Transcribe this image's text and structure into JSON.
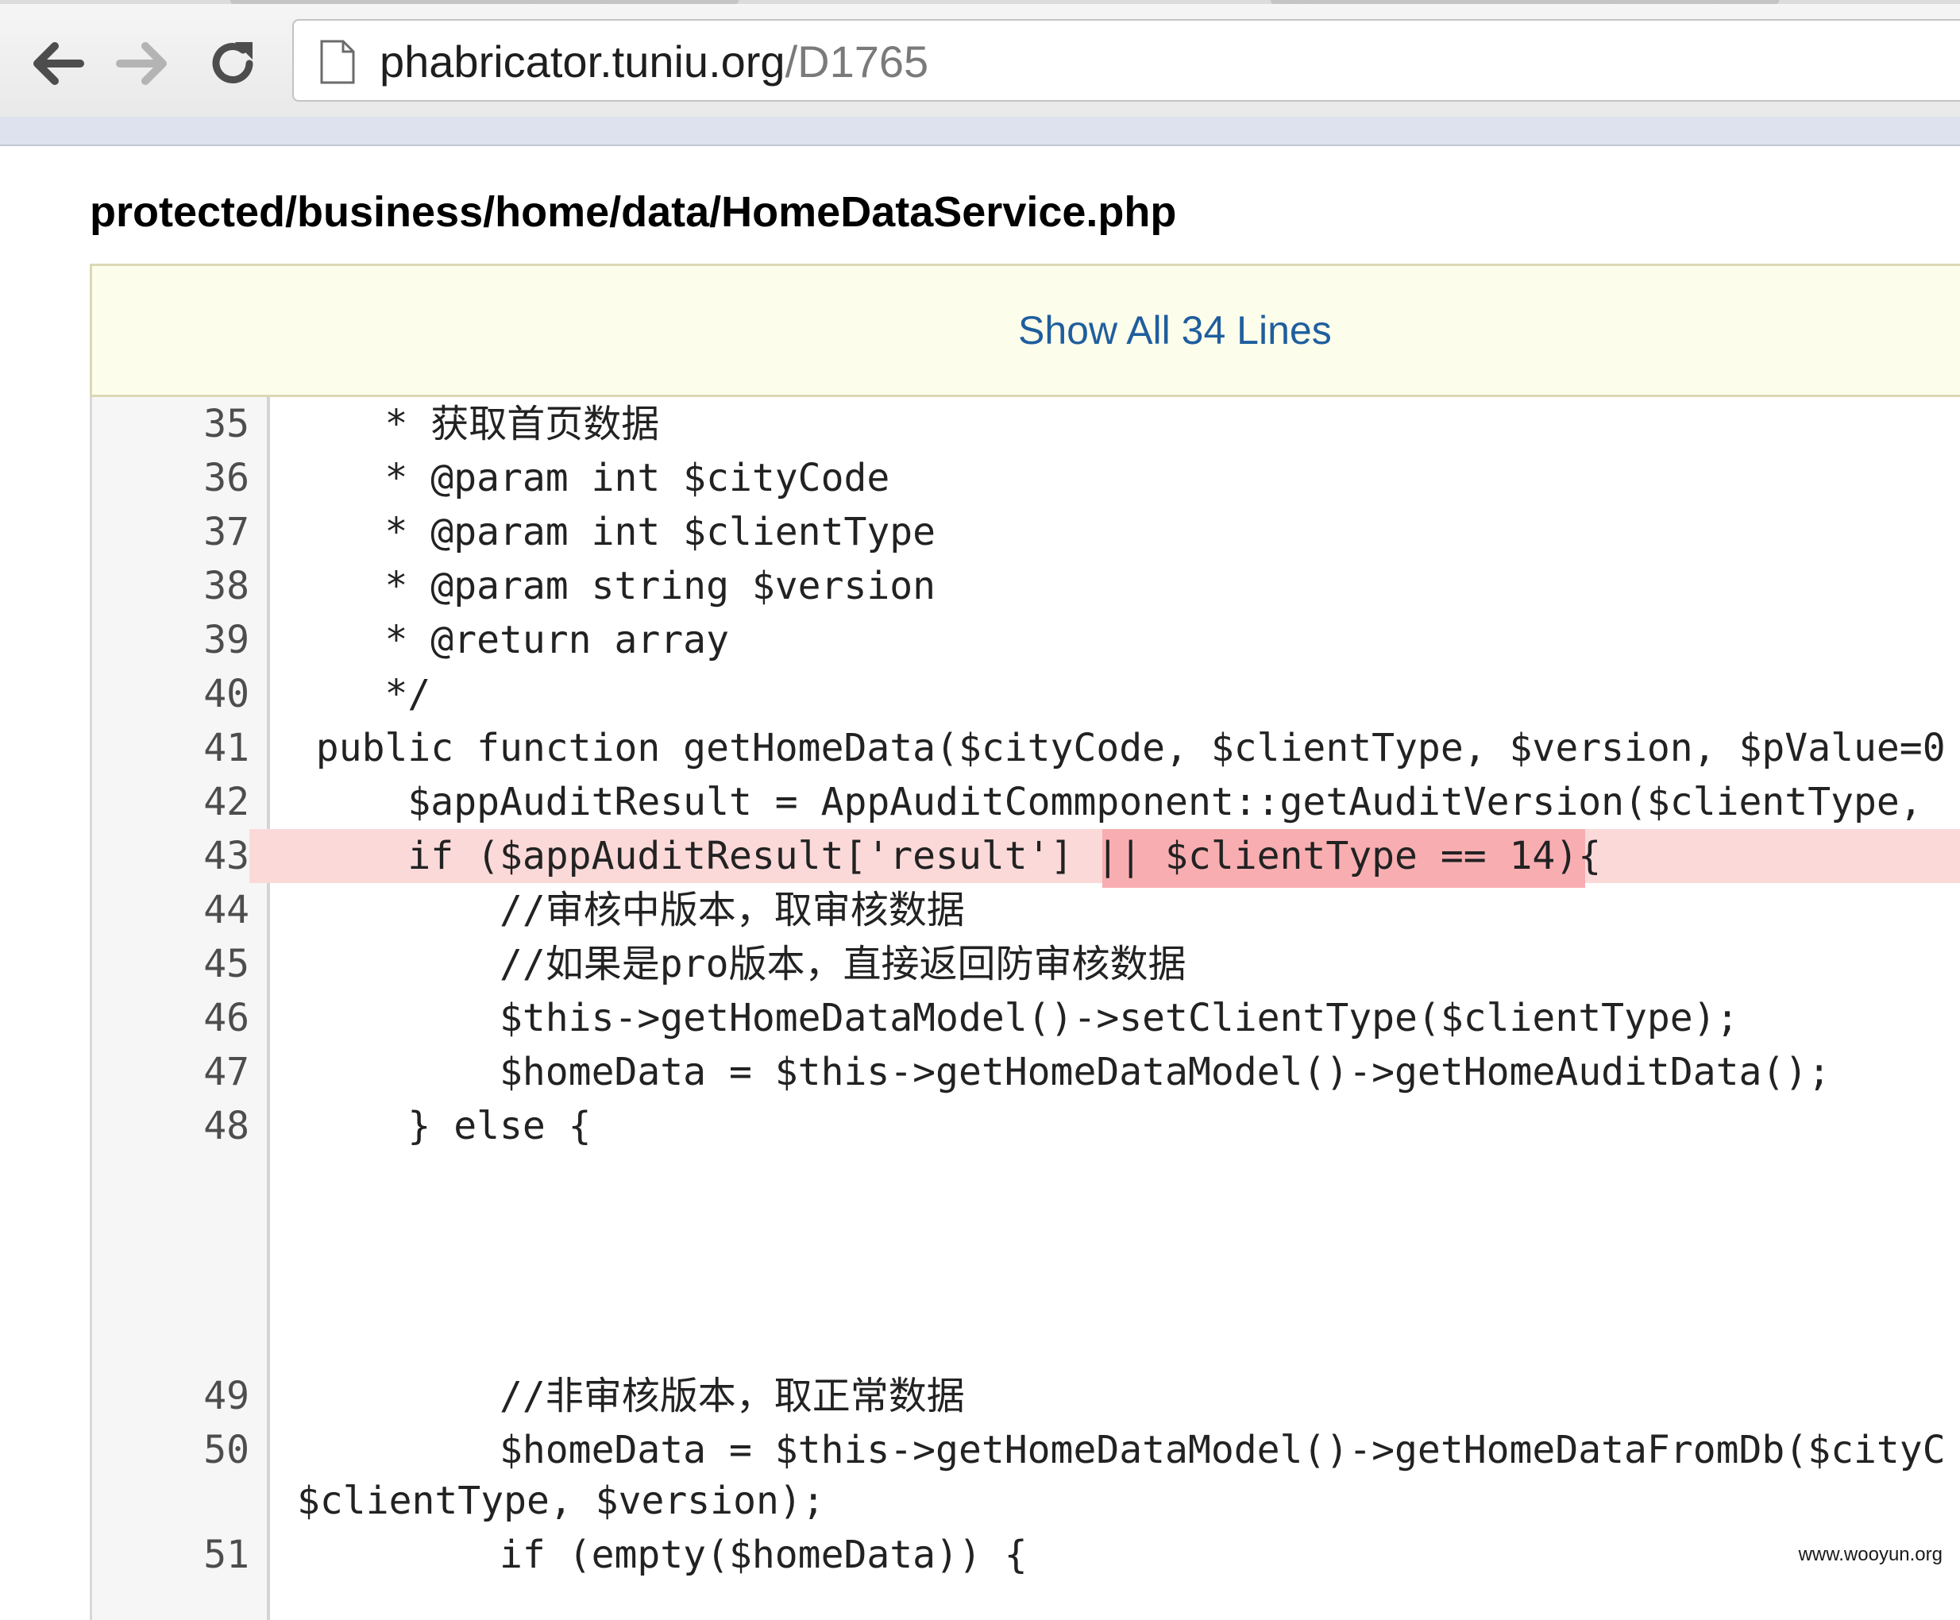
{
  "browser": {
    "url_host": "phabricator.tuniu.org",
    "url_path": "/D1765"
  },
  "file": {
    "path": "protected/business/home/data/HomeDataService.php"
  },
  "diff": {
    "show_all_label": "Show All 34 Lines",
    "lines": [
      {
        "num": "35",
        "text": "     * 获取首页数据"
      },
      {
        "num": "36",
        "text": "     * @param int $cityCode"
      },
      {
        "num": "37",
        "text": "     * @param int $clientType"
      },
      {
        "num": "38",
        "text": "     * @param string $version"
      },
      {
        "num": "39",
        "text": "     * @return array"
      },
      {
        "num": "40",
        "text": "     */"
      },
      {
        "num": "41",
        "text": "  public function getHomeData($cityCode, $clientType, $version, $pValue=0"
      },
      {
        "num": "42",
        "text": "      $appAuditResult = AppAuditCommponent::getAuditVersion($clientType,"
      },
      {
        "num": "43",
        "text": "      if ($appAuditResult['result'] || $clientType == 14){",
        "highlight": true
      },
      {
        "num": "44",
        "text": "          //审核中版本，取审核数据"
      },
      {
        "num": "45",
        "text": "          //如果是pro版本，直接返回防审核数据"
      },
      {
        "num": "46",
        "text": "          $this->getHomeDataModel()->setClientType($clientType);"
      },
      {
        "num": "47",
        "text": "          $homeData = $this->getHomeDataModel()->getHomeAuditData();"
      },
      {
        "num": "48",
        "text": "      } else {"
      },
      {
        "num": "49",
        "text": "          //非审核版本，取正常数据"
      },
      {
        "num": "50",
        "text": "          $homeData = $this->getHomeDataModel()->getHomeDataFromDb($cityC"
      },
      {
        "num": "",
        "text": "$clientType, $version);"
      },
      {
        "num": "51",
        "text": "          if (empty($homeData)) {"
      }
    ]
  },
  "watermark": "www.wooyun.org"
}
